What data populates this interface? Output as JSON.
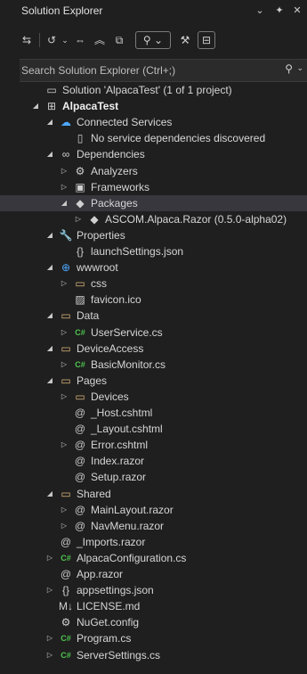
{
  "window": {
    "title": "Solution Explorer"
  },
  "search": {
    "placeholder": "Search Solution Explorer (Ctrl+;)"
  },
  "tree": [
    {
      "label": "Solution 'AlpacaTest' (1 of 1 project)",
      "depth": 0,
      "exp": "",
      "icon": "solution-icon",
      "sym": "▭",
      "cls": "ico-file"
    },
    {
      "label": "AlpacaTest",
      "depth": 0,
      "exp": "◢",
      "icon": "web-project-icon",
      "sym": "⊞",
      "cls": "ico-file",
      "bold": true
    },
    {
      "label": "Connected Services",
      "depth": 1,
      "exp": "◢",
      "icon": "connected-services-icon",
      "sym": "☁",
      "cls": "ico-blue"
    },
    {
      "label": "No service dependencies discovered",
      "depth": 2,
      "exp": "",
      "icon": "file-icon",
      "sym": "▯",
      "cls": "ico-file"
    },
    {
      "label": "Dependencies",
      "depth": 1,
      "exp": "◢",
      "icon": "dependencies-icon",
      "sym": "∞",
      "cls": "ico-file"
    },
    {
      "label": "Analyzers",
      "depth": 2,
      "exp": "▷",
      "icon": "analyzers-icon",
      "sym": "⚙",
      "cls": "ico-file"
    },
    {
      "label": "Frameworks",
      "depth": 2,
      "exp": "▷",
      "icon": "frameworks-icon",
      "sym": "▣",
      "cls": "ico-file"
    },
    {
      "label": "Packages",
      "depth": 2,
      "exp": "◢",
      "icon": "packages-icon",
      "sym": "◆",
      "cls": "ico-pkg",
      "selected": true
    },
    {
      "label": "ASCOM.Alpaca.Razor (0.5.0-alpha02)",
      "depth": 3,
      "exp": "▷",
      "icon": "package-icon",
      "sym": "◆",
      "cls": "ico-pkg"
    },
    {
      "label": "Properties",
      "depth": 1,
      "exp": "◢",
      "icon": "properties-icon",
      "sym": "🔧",
      "cls": "ico-file"
    },
    {
      "label": "launchSettings.json",
      "depth": 2,
      "exp": "",
      "icon": "json-icon",
      "sym": "{}",
      "cls": "ico-file"
    },
    {
      "label": "wwwroot",
      "depth": 1,
      "exp": "◢",
      "icon": "globe-icon",
      "sym": "⊕",
      "cls": "ico-blue"
    },
    {
      "label": "css",
      "depth": 2,
      "exp": "▷",
      "icon": "folder-icon",
      "sym": "▭",
      "cls": "ico-folder"
    },
    {
      "label": "favicon.ico",
      "depth": 2,
      "exp": "",
      "icon": "image-file-icon",
      "sym": "▨",
      "cls": "ico-file"
    },
    {
      "label": "Data",
      "depth": 1,
      "exp": "◢",
      "icon": "folder-icon",
      "sym": "▭",
      "cls": "ico-folder"
    },
    {
      "label": "UserService.cs",
      "depth": 2,
      "exp": "▷",
      "icon": "csharp-icon",
      "sym": "C#",
      "cls": "ico-cs"
    },
    {
      "label": "DeviceAccess",
      "depth": 1,
      "exp": "◢",
      "icon": "folder-icon",
      "sym": "▭",
      "cls": "ico-folder"
    },
    {
      "label": "BasicMonitor.cs",
      "depth": 2,
      "exp": "▷",
      "icon": "csharp-icon",
      "sym": "C#",
      "cls": "ico-cs"
    },
    {
      "label": "Pages",
      "depth": 1,
      "exp": "◢",
      "icon": "folder-icon",
      "sym": "▭",
      "cls": "ico-folder"
    },
    {
      "label": "Devices",
      "depth": 2,
      "exp": "▷",
      "icon": "folder-icon",
      "sym": "▭",
      "cls": "ico-folder"
    },
    {
      "label": "_Host.cshtml",
      "depth": 2,
      "exp": "",
      "icon": "razor-icon",
      "sym": "@",
      "cls": "ico-razor"
    },
    {
      "label": "_Layout.cshtml",
      "depth": 2,
      "exp": "",
      "icon": "razor-icon",
      "sym": "@",
      "cls": "ico-razor"
    },
    {
      "label": "Error.cshtml",
      "depth": 2,
      "exp": "▷",
      "icon": "razor-icon",
      "sym": "@",
      "cls": "ico-razor"
    },
    {
      "label": "Index.razor",
      "depth": 2,
      "exp": "",
      "icon": "razor-icon",
      "sym": "@",
      "cls": "ico-razor"
    },
    {
      "label": "Setup.razor",
      "depth": 2,
      "exp": "",
      "icon": "razor-icon",
      "sym": "@",
      "cls": "ico-razor"
    },
    {
      "label": "Shared",
      "depth": 1,
      "exp": "◢",
      "icon": "folder-icon",
      "sym": "▭",
      "cls": "ico-folder"
    },
    {
      "label": "MainLayout.razor",
      "depth": 2,
      "exp": "▷",
      "icon": "razor-icon",
      "sym": "@",
      "cls": "ico-razor"
    },
    {
      "label": "NavMenu.razor",
      "depth": 2,
      "exp": "▷",
      "icon": "razor-icon",
      "sym": "@",
      "cls": "ico-razor"
    },
    {
      "label": "_Imports.razor",
      "depth": 1,
      "exp": "",
      "icon": "razor-icon",
      "sym": "@",
      "cls": "ico-razor"
    },
    {
      "label": "AlpacaConfiguration.cs",
      "depth": 1,
      "exp": "▷",
      "icon": "csharp-icon",
      "sym": "C#",
      "cls": "ico-cs"
    },
    {
      "label": "App.razor",
      "depth": 1,
      "exp": "",
      "icon": "razor-icon",
      "sym": "@",
      "cls": "ico-razor"
    },
    {
      "label": "appsettings.json",
      "depth": 1,
      "exp": "▷",
      "icon": "json-icon",
      "sym": "{}",
      "cls": "ico-file"
    },
    {
      "label": "LICENSE.md",
      "depth": 1,
      "exp": "",
      "icon": "markdown-icon",
      "sym": "M↓",
      "cls": "ico-file"
    },
    {
      "label": "NuGet.config",
      "depth": 1,
      "exp": "",
      "icon": "config-icon",
      "sym": "⚙",
      "cls": "ico-file"
    },
    {
      "label": "Program.cs",
      "depth": 1,
      "exp": "▷",
      "icon": "csharp-icon",
      "sym": "C#",
      "cls": "ico-cs"
    },
    {
      "label": "ServerSettings.cs",
      "depth": 1,
      "exp": "▷",
      "icon": "csharp-icon",
      "sym": "C#",
      "cls": "ico-cs"
    }
  ]
}
